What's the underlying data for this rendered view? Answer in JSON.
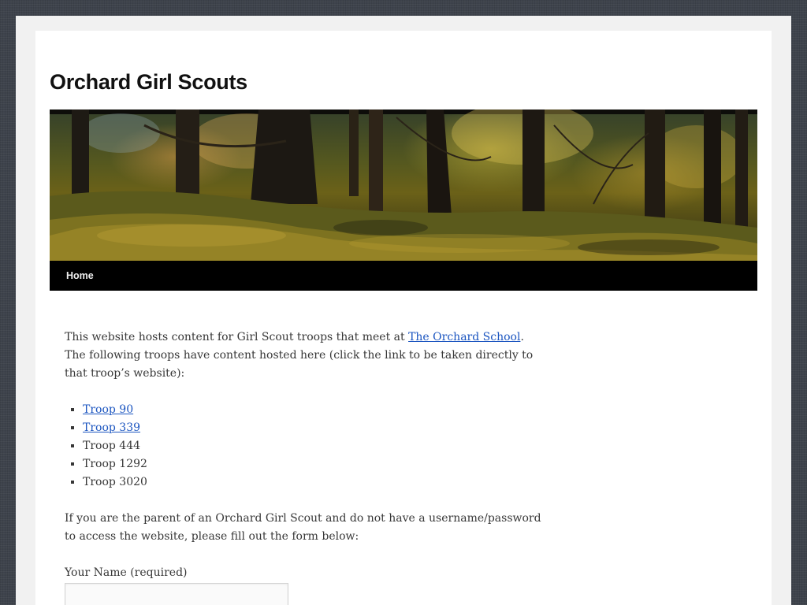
{
  "site": {
    "title": "Orchard Girl Scouts"
  },
  "nav": {
    "items": [
      {
        "label": "Home"
      }
    ]
  },
  "main": {
    "intro_prefix": "This website hosts content for Girl Scout troops that meet at ",
    "intro_link": "The Orchard School",
    "intro_suffix": ". The following troops have content hosted here (click the link to be taken directly to that troop’s website):",
    "troops": [
      {
        "label": "Troop 90",
        "linked": true
      },
      {
        "label": "Troop 339",
        "linked": true
      },
      {
        "label": "Troop 444",
        "linked": false
      },
      {
        "label": "Troop 1292",
        "linked": false
      },
      {
        "label": "Troop 3020",
        "linked": false
      }
    ],
    "form_intro": "If you are the parent of an Orchard Girl Scout and do not have a username/password to access the website, please fill out the form below:"
  },
  "form": {
    "name_label": "Your Name (required)",
    "name_value": ""
  },
  "colors": {
    "link": "#1b55c0",
    "nav_background": "#000000",
    "body_text": "#373737"
  }
}
